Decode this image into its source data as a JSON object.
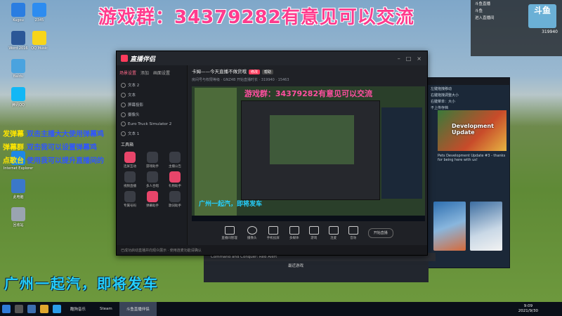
{
  "overlays": {
    "top": "游戏群：34379282有意见可以交流",
    "bottom": "广州一起汽，即将发车",
    "danmu": [
      {
        "tag": "发弹幕",
        "text": "双击主播大大使用弹幕鸡"
      },
      {
        "tag": "弹幕群",
        "text": "双击我可以设置弹幕鸡"
      },
      {
        "tag": "点歌台",
        "text": "使用我可以提升直播间的"
      }
    ]
  },
  "desktop_icons": [
    {
      "label": "Kugou",
      "color": "#2a7de1"
    },
    {
      "label": "Word 2016",
      "color": "#2b5797"
    },
    {
      "label": "Baidu",
      "color": "#4aa3df"
    },
    {
      "label": "腾讯QQ",
      "color": "#12b7f5"
    },
    {
      "label": "2345",
      "color": "#2d8cf0"
    },
    {
      "label": "Internet Explorer",
      "color": "#1e88e5"
    },
    {
      "label": "QQ Music",
      "color": "#f7d51a"
    },
    {
      "label": "此电脑",
      "color": "#3b78c9"
    },
    {
      "label": "回收站",
      "color": "#9aa4b0"
    }
  ],
  "window": {
    "app_name": "直播伴侣",
    "sidebar_tabs": [
      "场景设置",
      "添加",
      "画面设置"
    ],
    "scenes": [
      "文本 2",
      "文本",
      "屏幕投影",
      "摄像头",
      "Euro Truck Simulator 2",
      "文本 1"
    ],
    "toolbox_title": "工具箱",
    "tools": [
      "连屏互动",
      "游戏助手",
      "主播公告",
      "视频直播",
      "多人合唱",
      "礼物助手",
      "专属号码",
      "弹幕助手",
      "歌词助手"
    ],
    "room_title": "卡姆——今天直播不做货哦",
    "room_tag": "修改",
    "room_tag2": "帮助",
    "room_meta": "房间号与权限等级 · GNZ4B 开始直播时长 · 319940 · 15463",
    "controls": [
      "直播间管理",
      "摄像头",
      "手机投屏",
      "多媒体",
      "游戏",
      "连麦",
      "音效"
    ],
    "start_label": "开始直播",
    "status": "已成功启动直播并向观众展示 · 使用连麦功能请确认"
  },
  "steam": {
    "news": [
      "左键拖拽移动",
      "右键拖拽调整大小",
      "右键菜单：大小",
      "不上传存档",
      "设置：同步",
      "设定开通"
    ],
    "banner_title": "Development Update",
    "banner_caption": "Pets Development Update #3 - thanks for being here with us!",
    "cnc_title": "Command and Conquer: Red Alert",
    "recent_label": "最近游戏"
  },
  "right_panel": {
    "lines": [
      "斗鱼直播",
      "斗鱼",
      "319940",
      "进入直播间"
    ],
    "logo_text": "斗鱼"
  },
  "taskbar": {
    "apps": [
      "酷狗音乐",
      "Steam",
      "斗鱼直播伴侣"
    ],
    "time": "9:09",
    "date": "2021/9/30"
  }
}
